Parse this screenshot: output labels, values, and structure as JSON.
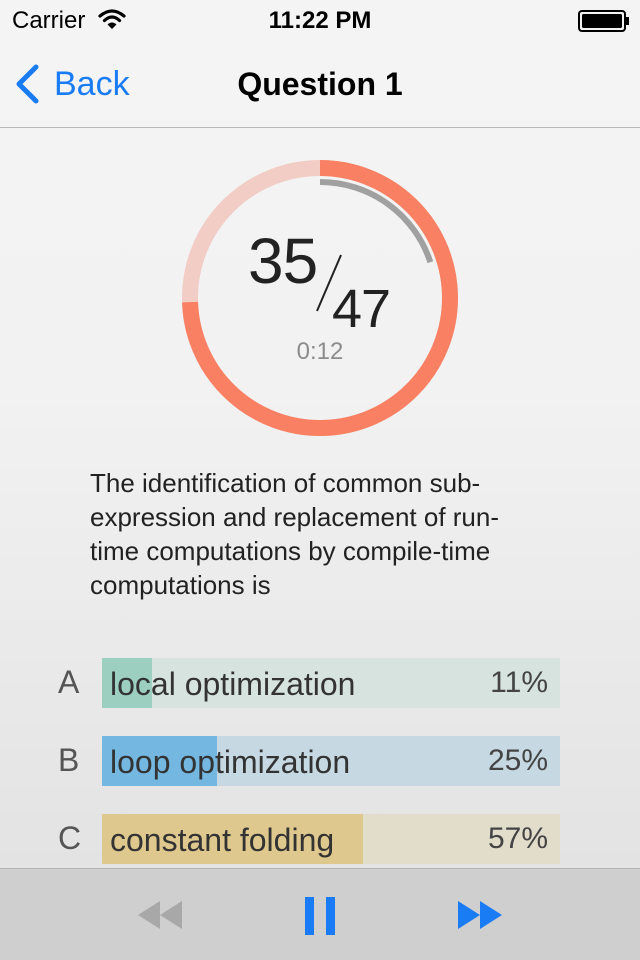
{
  "status_bar": {
    "carrier": "Carrier",
    "time": "11:22 PM"
  },
  "nav": {
    "back_label": "Back",
    "title": "Question 1"
  },
  "progress": {
    "current": "35",
    "total": "47",
    "fraction": 0.745,
    "timer": "0:12",
    "timer_fraction": 0.2,
    "colors": {
      "ring": "#fa8064",
      "ring_track": "#f1cdc5",
      "timer": "#a0a0a0"
    }
  },
  "question": {
    "text": "The identification of common sub-expression and replacement of run-time computations by compile-time computations is"
  },
  "answers": [
    {
      "letter": "A",
      "label": "local optimization",
      "percent_text": "11%",
      "fraction": 0.11,
      "fill_color": "#9ccfbf",
      "bar_color": "#d6e3de"
    },
    {
      "letter": "B",
      "label": "loop optimization",
      "percent_text": "25%",
      "fraction": 0.25,
      "fill_color": "#74b8e2",
      "bar_color": "#c6d9e3"
    },
    {
      "letter": "C",
      "label": "constant folding",
      "percent_text": "57%",
      "fraction": 0.57,
      "fill_color": "#dfc88e",
      "bar_color": "#e2dccb"
    }
  ],
  "toolbar": {
    "rewind_icon": "rewind-icon",
    "pause_icon": "pause-icon",
    "forward_icon": "fast-forward-icon",
    "colors": {
      "active": "#1a7cf5",
      "disabled": "#a8a8a8"
    }
  }
}
